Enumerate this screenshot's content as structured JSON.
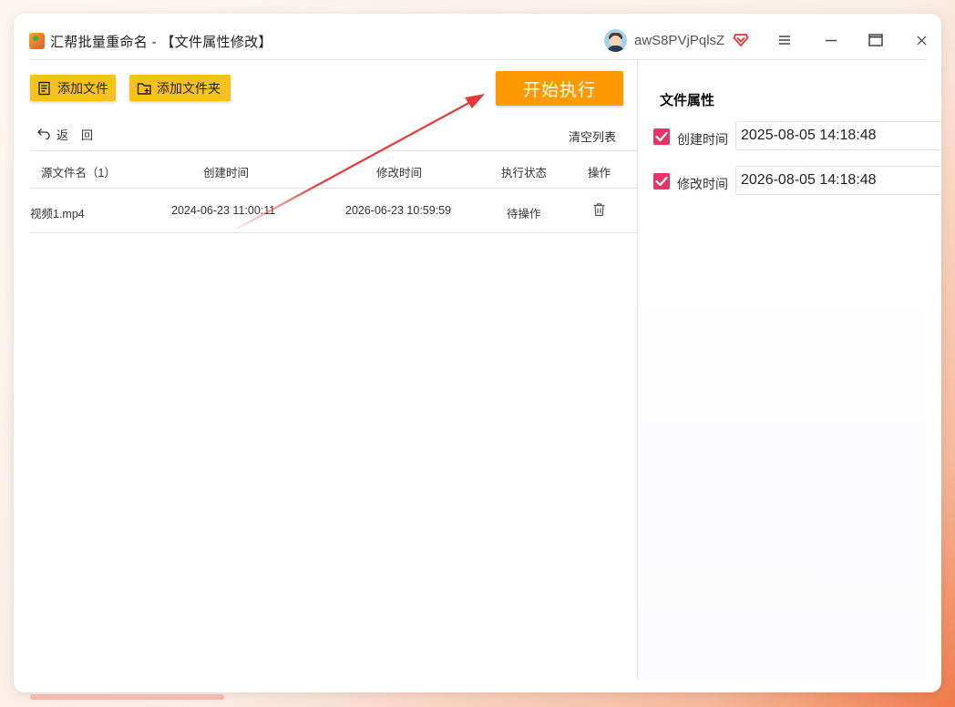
{
  "window": {
    "title": "汇帮批量重命名 - 【文件属性修改】",
    "username": "awS8PVjPqlsZ"
  },
  "toolbar": {
    "add_file_label": "添加文件",
    "add_folder_label": "添加文件夹",
    "start_label": "开始执行",
    "back_label": "返回",
    "clear_label": "清空列表"
  },
  "table": {
    "headers": [
      "源文件名（1）",
      "创建时间",
      "修改时间",
      "执行状态",
      "操作"
    ],
    "rows": [
      {
        "name": "视频1.mp4",
        "created": "2024-06-23 11:00:11",
        "modified": "2026-06-23 10:59:59",
        "status": "待操作",
        "action_icon": "trash-icon"
      }
    ]
  },
  "properties": {
    "title": "文件属性",
    "items": [
      {
        "label": "创建时间",
        "checked": true,
        "value": "2025-08-05 14:18:48"
      },
      {
        "label": "修改时间",
        "checked": true,
        "value": "2026-08-05 14:18:48"
      }
    ]
  },
  "colors": {
    "accent_yellow": "#f8c21a",
    "start_orange": "#ff9900",
    "checkbox_pink": "#e8336a",
    "annotation_red": "#e53935"
  }
}
